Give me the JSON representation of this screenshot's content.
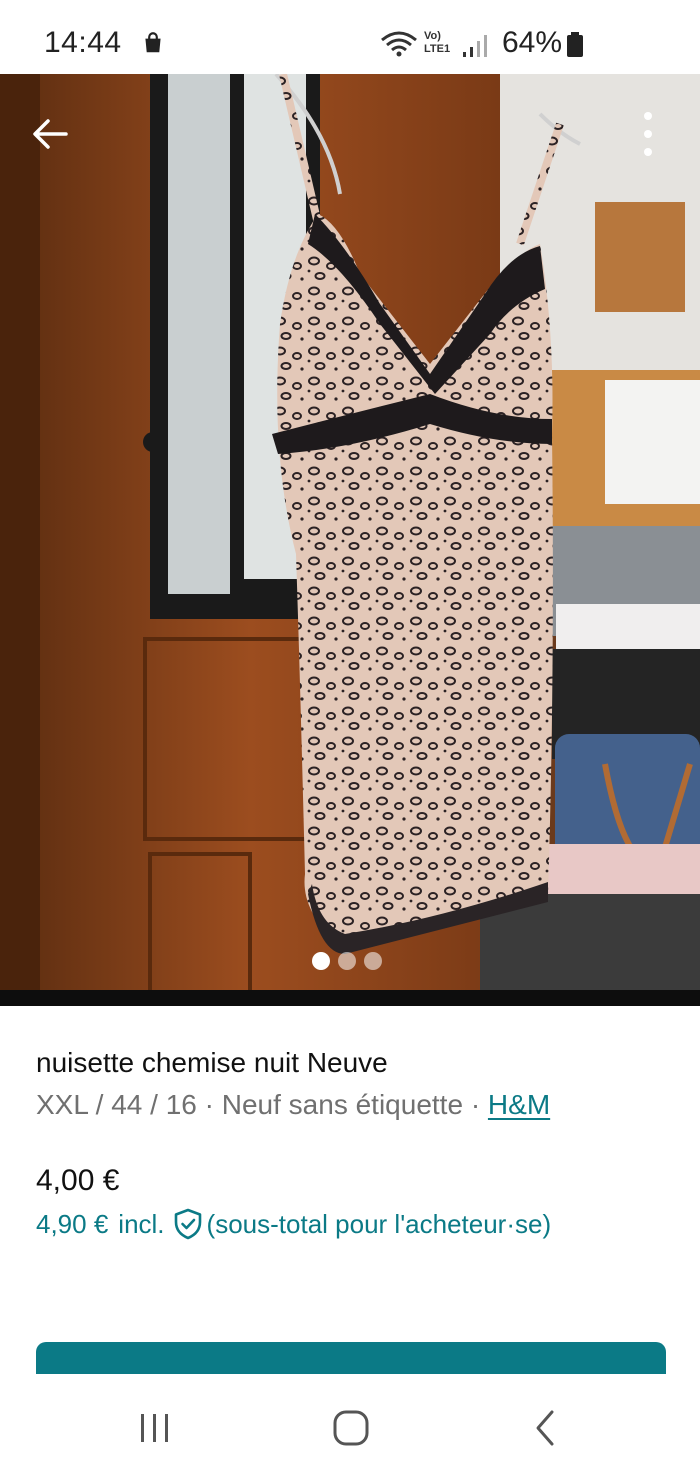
{
  "status_bar": {
    "time": "14:44",
    "network_label": "Vo) LTE1",
    "battery_percent": "64%"
  },
  "listing": {
    "title": "nuisette chemise nuit Neuve",
    "size": "XXL / 44 / 16",
    "separator": "·",
    "condition": "Neuf sans étiquette",
    "brand": "H&M",
    "price": "4,00 €",
    "price_incl": "4,90 €",
    "incl_label": "incl.",
    "subtotal_note": "(sous-total pour l'acheteur·se)"
  },
  "gallery": {
    "image_count": 3,
    "active_index": 0
  },
  "icons": {
    "back": "arrow-left-icon",
    "more": "more-vertical-icon",
    "shield": "shield-check-icon",
    "nav_recents": "recents-icon",
    "nav_home": "home-icon",
    "nav_back": "chevron-left-icon"
  },
  "colors": {
    "accent": "#0b7a86",
    "text_primary": "#111111",
    "text_secondary": "#707070"
  }
}
